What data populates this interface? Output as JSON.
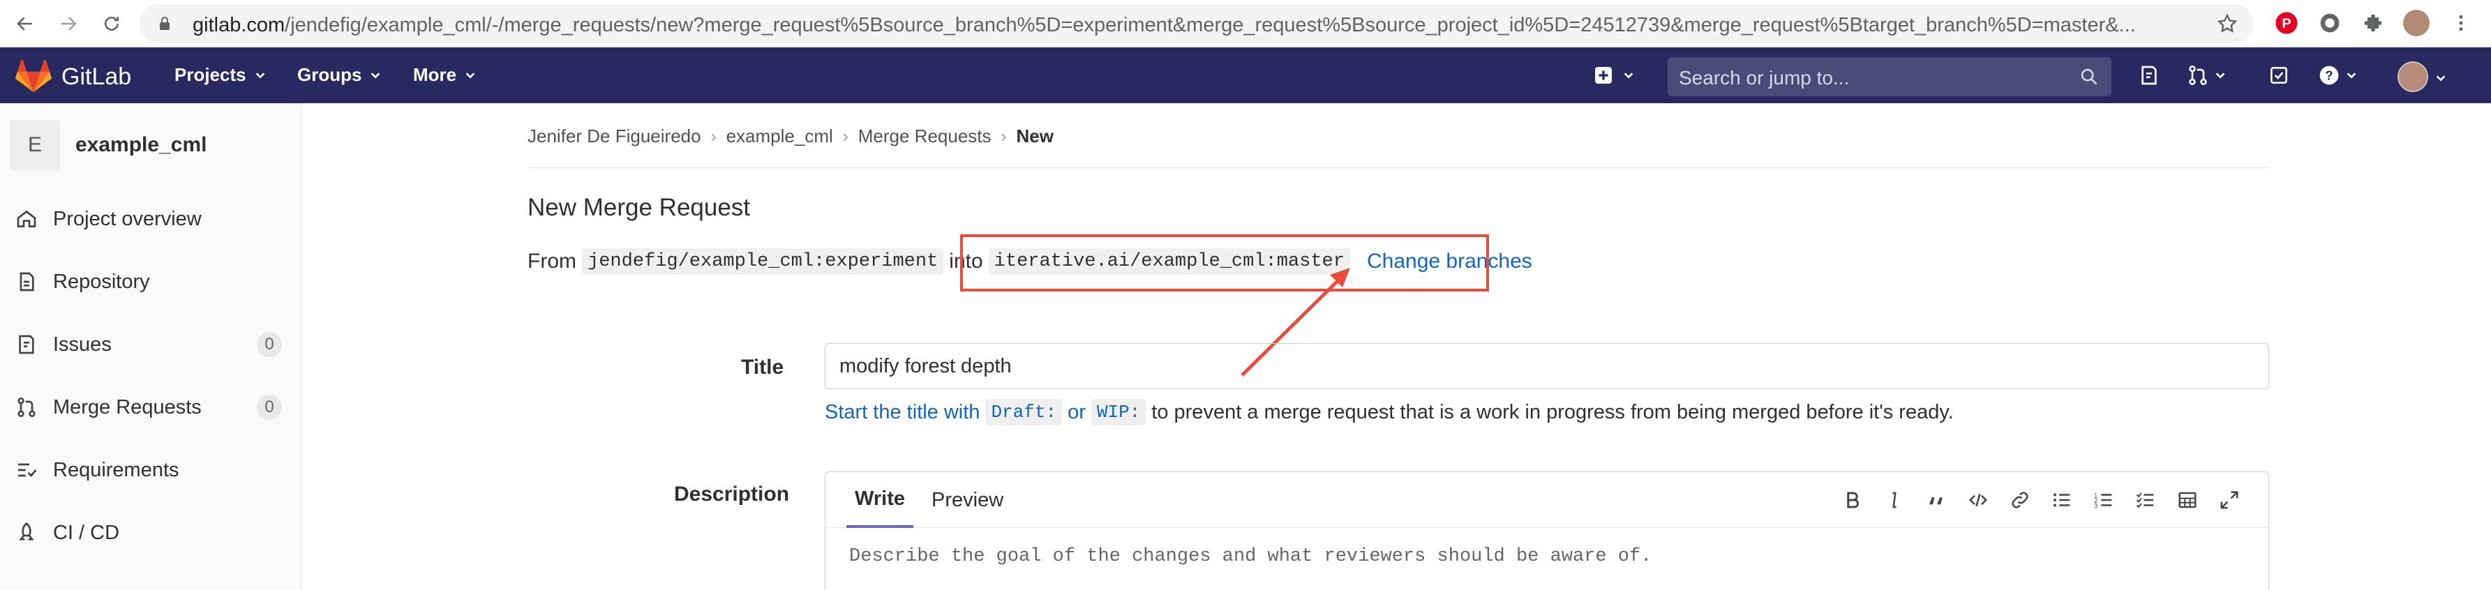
{
  "browser": {
    "url_host": "gitlab.com",
    "url_path": "/jendefig/example_cml/-/merge_requests/new?merge_request%5Bsource_branch%5D=experiment&merge_request%5Bsource_project_id%5D=24512739&merge_request%5Btarget_branch%5D=master&..."
  },
  "topbar": {
    "brand": "GitLab",
    "menus": [
      "Projects",
      "Groups",
      "More"
    ],
    "search_placeholder": "Search or jump to..."
  },
  "sidebar": {
    "project_initial": "E",
    "project_name": "example_cml",
    "items": [
      {
        "label": "Project overview",
        "icon": "home-icon"
      },
      {
        "label": "Repository",
        "icon": "doc-icon"
      },
      {
        "label": "Issues",
        "icon": "issues-icon",
        "count": "0"
      },
      {
        "label": "Merge Requests",
        "icon": "merge-request-icon",
        "count": "0"
      },
      {
        "label": "Requirements",
        "icon": "requirements-icon"
      },
      {
        "label": "CI / CD",
        "icon": "rocket-icon"
      }
    ]
  },
  "breadcrumb": [
    "Jenifer De Figueiredo",
    "example_cml",
    "Merge Requests",
    "New"
  ],
  "page": {
    "title": "New Merge Request",
    "from_word": "From",
    "source": "jendefig/example_cml:experiment",
    "into_word": "into",
    "target": "iterative.ai/example_cml:master",
    "change_branches": "Change branches"
  },
  "form": {
    "title_label": "Title",
    "title_value": "modify forest depth",
    "hint_prefix": "Start the title with",
    "hint_draft": "Draft:",
    "hint_or": "or",
    "hint_wip": "WIP:",
    "hint_suffix": "to prevent a merge request that is a work in progress from being merged before it's ready.",
    "description_label": "Description",
    "tab_write": "Write",
    "tab_preview": "Preview",
    "description_placeholder": "Describe the goal of the changes and what reviewers should be aware of."
  },
  "colors": {
    "topbar": "#292961",
    "link": "#1068bf",
    "annotation": "#e74c3c"
  }
}
